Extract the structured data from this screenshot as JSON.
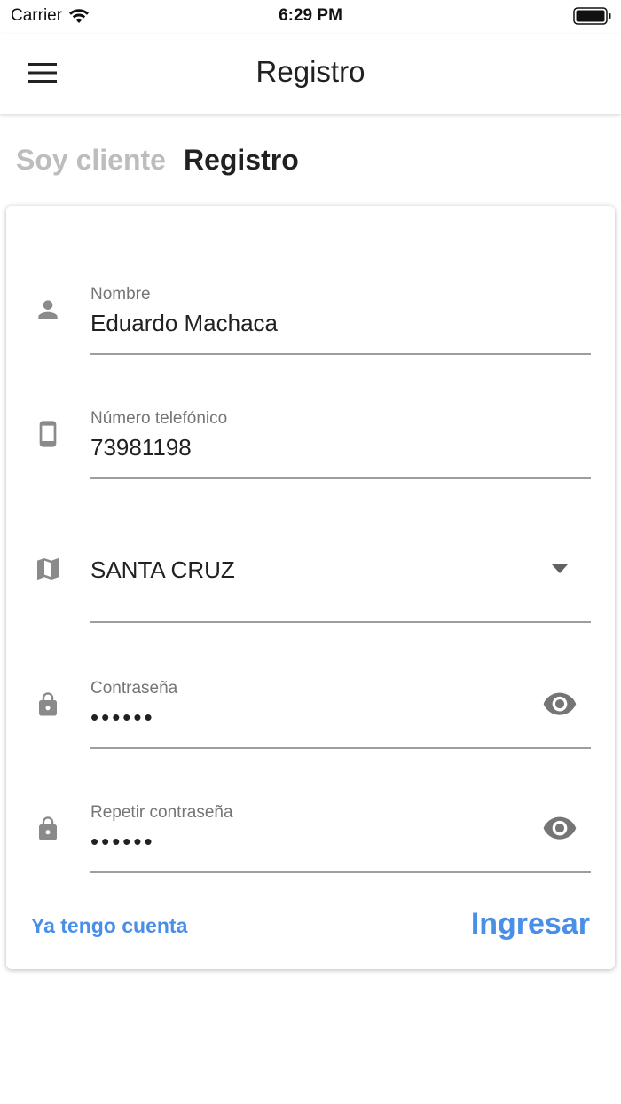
{
  "status_bar": {
    "carrier": "Carrier",
    "time": "6:29 PM",
    "icons": [
      "wifi-icon",
      "battery-icon"
    ]
  },
  "app_bar": {
    "title": "Registro",
    "menu_icon": "hamburger-menu-icon"
  },
  "tabs": [
    {
      "label": "Soy cliente",
      "active": false
    },
    {
      "label": "Registro",
      "active": true
    }
  ],
  "form": {
    "name": {
      "label": "Nombre",
      "value": "Eduardo Machaca",
      "icon": "person-icon"
    },
    "phone": {
      "label": "Número telefónico",
      "value": "73981198",
      "icon": "smartphone-icon"
    },
    "city": {
      "value": "SANTA CRUZ",
      "icon": "map-icon"
    },
    "password": {
      "label": "Contraseña",
      "value": "••••••",
      "icon": "lock-icon"
    },
    "password_repeat": {
      "label": "Repetir contraseña",
      "value": "••••••",
      "icon": "lock-icon"
    }
  },
  "actions": {
    "secondary": "Ya tengo cuenta",
    "primary": "Ingresar"
  },
  "colors": {
    "accent": "#4a8fe7",
    "inactive_tab": "#bdbdbd",
    "icon": "#8a8a8a"
  }
}
